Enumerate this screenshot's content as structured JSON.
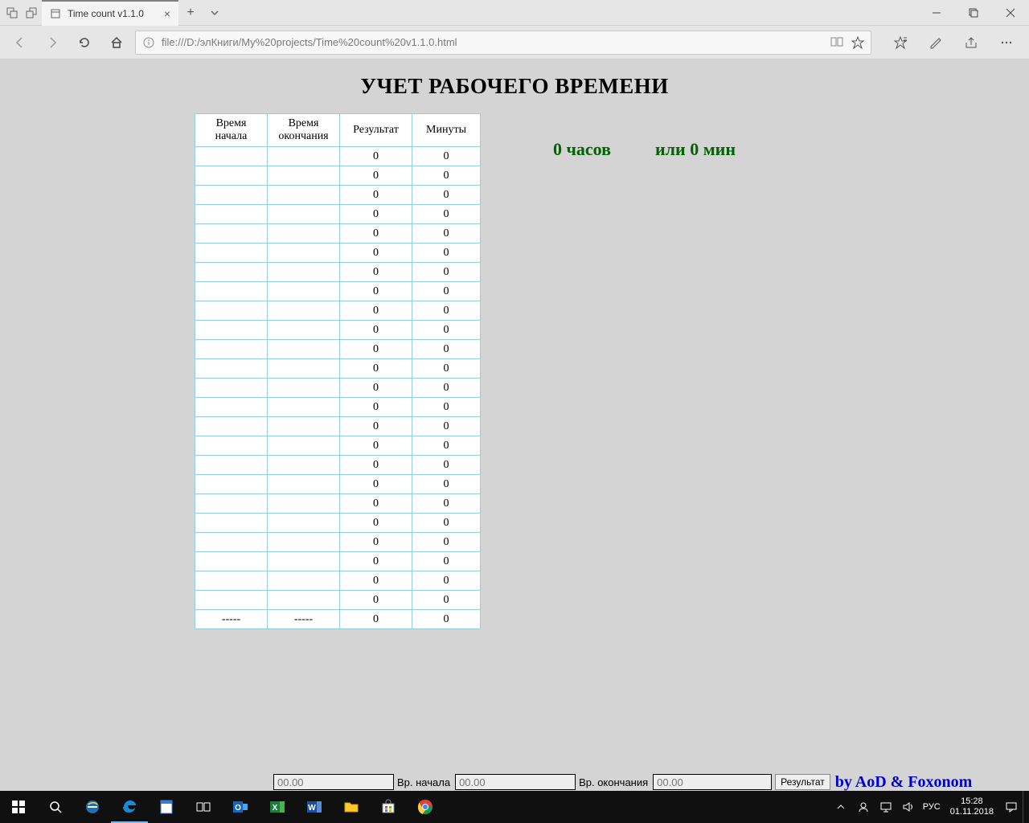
{
  "browser": {
    "tab_title": "Time count v1.1.0",
    "url": "file:///D:/элКниги/My%20projects/Time%20count%20v1.1.0.html"
  },
  "page": {
    "heading": "УЧЕТ РАБОЧЕГО ВРЕМЕНИ",
    "columns": {
      "c1": "Время начала",
      "c2": "Время\nокончания",
      "c3": "Результат",
      "c4": "Минуты"
    },
    "rows": [
      {
        "start": "",
        "end": "",
        "result": "0",
        "minutes": "0"
      },
      {
        "start": "",
        "end": "",
        "result": "0",
        "minutes": "0"
      },
      {
        "start": "",
        "end": "",
        "result": "0",
        "minutes": "0"
      },
      {
        "start": "",
        "end": "",
        "result": "0",
        "minutes": "0"
      },
      {
        "start": "",
        "end": "",
        "result": "0",
        "minutes": "0"
      },
      {
        "start": "",
        "end": "",
        "result": "0",
        "minutes": "0"
      },
      {
        "start": "",
        "end": "",
        "result": "0",
        "minutes": "0"
      },
      {
        "start": "",
        "end": "",
        "result": "0",
        "minutes": "0"
      },
      {
        "start": "",
        "end": "",
        "result": "0",
        "minutes": "0"
      },
      {
        "start": "",
        "end": "",
        "result": "0",
        "minutes": "0"
      },
      {
        "start": "",
        "end": "",
        "result": "0",
        "minutes": "0"
      },
      {
        "start": "",
        "end": "",
        "result": "0",
        "minutes": "0"
      },
      {
        "start": "",
        "end": "",
        "result": "0",
        "minutes": "0"
      },
      {
        "start": "",
        "end": "",
        "result": "0",
        "minutes": "0"
      },
      {
        "start": "",
        "end": "",
        "result": "0",
        "minutes": "0"
      },
      {
        "start": "",
        "end": "",
        "result": "0",
        "minutes": "0"
      },
      {
        "start": "",
        "end": "",
        "result": "0",
        "minutes": "0"
      },
      {
        "start": "",
        "end": "",
        "result": "0",
        "minutes": "0"
      },
      {
        "start": "",
        "end": "",
        "result": "0",
        "minutes": "0"
      },
      {
        "start": "",
        "end": "",
        "result": "0",
        "minutes": "0"
      },
      {
        "start": "",
        "end": "",
        "result": "0",
        "minutes": "0"
      },
      {
        "start": "",
        "end": "",
        "result": "0",
        "minutes": "0"
      },
      {
        "start": "",
        "end": "",
        "result": "0",
        "minutes": "0"
      },
      {
        "start": "",
        "end": "",
        "result": "0",
        "minutes": "0"
      },
      {
        "start": "-----",
        "end": "-----",
        "result": "0",
        "minutes": "0"
      }
    ],
    "summary": "0 часов          или 0 мин",
    "credit": "by AoD & Foxonom"
  },
  "bottom_inputs": {
    "ph1": "00.00",
    "lbl1": "Вр. начала",
    "ph2": "00.00",
    "lbl2": "Вр. окончания",
    "ph3": "00.00",
    "btn": "Результат"
  },
  "taskbar": {
    "lang": "РУС",
    "time": "15:28",
    "date": "01.11.2018"
  }
}
